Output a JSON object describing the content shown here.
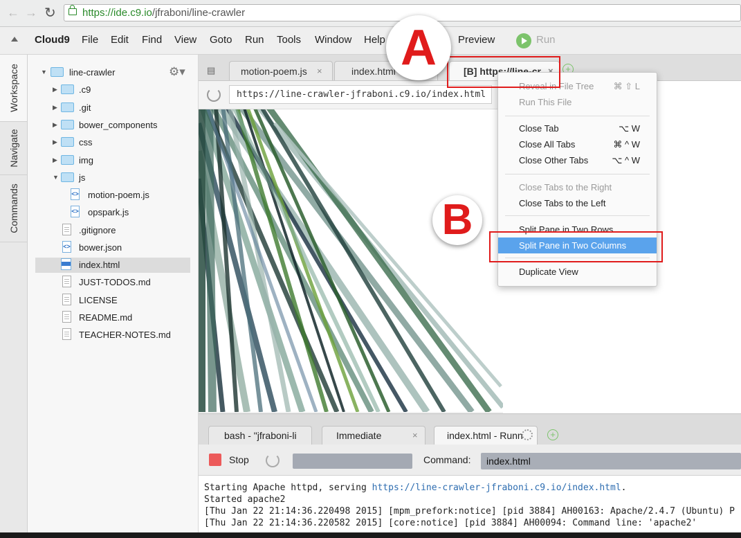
{
  "browser": {
    "url_scheme_host": "https://ide.c9.io",
    "url_path": "/jfraboni/line-crawler"
  },
  "menu": {
    "brand": "Cloud9",
    "items": [
      "File",
      "Edit",
      "Find",
      "View",
      "Goto",
      "Run",
      "Tools",
      "Window",
      "Help"
    ],
    "preview": "Preview",
    "run": "Run"
  },
  "side_tabs": [
    "Workspace",
    "Navigate",
    "Commands"
  ],
  "tree": {
    "root": "line-crawler",
    "folders": [
      ".c9",
      ".git",
      "bower_components",
      "css",
      "img",
      "js"
    ],
    "js_files": [
      "motion-poem.js",
      "opspark.js"
    ],
    "files": [
      ".gitignore",
      "bower.json",
      "index.html",
      "JUST-TODOS.md",
      "LICENSE",
      "README.md",
      "TEACHER-NOTES.md"
    ],
    "selected": "index.html"
  },
  "editor_tabs": [
    {
      "label": "motion-poem.js"
    },
    {
      "label": "index.html"
    },
    {
      "label": "[B] https://line-cr",
      "active": true
    }
  ],
  "preview_url": "https://line-crawler-jfraboni.c9.io/index.html",
  "context_menu": {
    "items": [
      {
        "label": "Reveal in File Tree",
        "shortcut": "⌘ ⇧ L",
        "disabled": true
      },
      {
        "label": "Run This File",
        "shortcut": "",
        "disabled": true
      },
      {
        "label": "Close Tab",
        "shortcut": "⌥ W"
      },
      {
        "label": "Close All Tabs",
        "shortcut": "⌘ ^ W"
      },
      {
        "label": "Close Other Tabs",
        "shortcut": "⌥ ^ W"
      },
      {
        "label": "Close Tabs to the Right",
        "shortcut": "",
        "disabled": true
      },
      {
        "label": "Close Tabs to the Left",
        "shortcut": ""
      },
      {
        "label": "Split Pane in Two Rows",
        "shortcut": ""
      },
      {
        "label": "Split Pane in Two Columns",
        "shortcut": "",
        "highlighted": true
      },
      {
        "label": "Duplicate View",
        "shortcut": ""
      }
    ]
  },
  "annotations": {
    "a": "A",
    "b": "B"
  },
  "console": {
    "tabs": [
      {
        "label": "bash - \"jfraboni-li"
      },
      {
        "label": "Immediate"
      },
      {
        "label": "index.html - Runn"
      }
    ],
    "stop_label": "Stop",
    "command_label": "Command:",
    "command_value": "index.html",
    "output": [
      {
        "pre": "Starting Apache httpd, serving ",
        "link": "https://line-crawler-jfraboni.c9.io/index.html",
        "post": "."
      },
      {
        "pre": "Started apache2"
      },
      {
        "pre": "[Thu Jan 22 21:14:36.220498 2015] [mpm_prefork:notice] [pid 3884] AH00163: Apache/2.4.7 (Ubuntu) P"
      },
      {
        "pre": "[Thu Jan 22 21:14:36.220582 2015] [core:notice] [pid 3884] AH00094: Command line: 'apache2'"
      }
    ]
  },
  "colors": {
    "accent": "#5aa3ec",
    "annotation": "#e01b1b",
    "run": "#7cc36b"
  }
}
